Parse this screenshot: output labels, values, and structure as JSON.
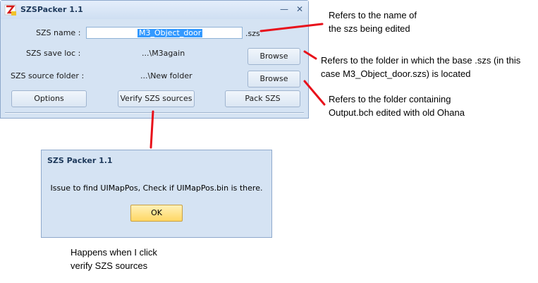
{
  "app": {
    "title": "SZSPacker 1.1",
    "minimize_glyph": "—",
    "close_glyph": "✕"
  },
  "form": {
    "szs_name_label": "SZS name :",
    "szs_name_value": "M3_Object_door",
    "szs_suffix": ".szs",
    "save_loc_label": "SZS save loc :",
    "save_loc_value": "...\\M3again",
    "source_folder_label": "SZS source folder :",
    "source_folder_value": "...\\New folder",
    "browse_label": "Browse"
  },
  "buttons": {
    "options": "Options",
    "verify": "Verify SZS sources",
    "pack": "Pack SZS"
  },
  "dialog": {
    "title": "SZS Packer 1.1",
    "message": "Issue to find UIMapPos, Check if UIMapPos.bin is there.",
    "ok": "OK"
  },
  "annotations": {
    "name_note": [
      "Refers to the name of",
      "the szs being edited"
    ],
    "save_note": [
      "Refers to the folder in which the base .szs (in this",
      "case M3_Object_door.szs) is located"
    ],
    "source_note": [
      "Refers to the folder containing",
      "Output.bch edited with old Ohana"
    ],
    "click_note": [
      "Happens when I click",
      "verify SZS sources"
    ]
  },
  "colors": {
    "arrow_red": "#e8111b",
    "selection": "#3399ff"
  }
}
